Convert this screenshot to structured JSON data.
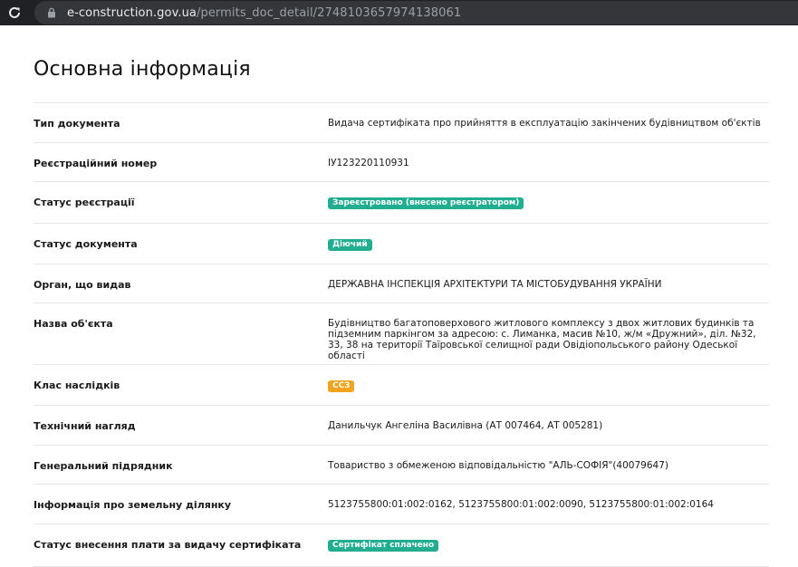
{
  "browser": {
    "url_host": "e-construction.gov.ua",
    "url_path": "/permits_doc_detail/2748103657974138061",
    "reload_icon": "reload-icon",
    "lock_icon": "lock-icon"
  },
  "page": {
    "title": "Основна інформація"
  },
  "rows": [
    {
      "label": "Тип документа",
      "value": "Видача сертифіката про прийняття в експлуатацію закінчених будівництвом об'єктів"
    },
    {
      "label": "Реєстраційний номер",
      "value": "ІУ123220110931"
    },
    {
      "label": "Статус реєстрації",
      "value": "Зареєстровано (внесено реєстратором)"
    },
    {
      "label": "Статус документа",
      "value": "Діючий"
    },
    {
      "label": "Орган, що видав",
      "value": "ДЕРЖАВНА ІНСПЕКЦІЯ АРХІТЕКТУРИ ТА МІСТОБУДУВАННЯ УКРАЇНИ"
    },
    {
      "label": "Назва об'єкта",
      "value": "Будівництво багатоповерхового житлового комплексу з двох житлових будинків та підземним паркінгом за адресою: с. Лиманка, масив №10, ж/м «Дружний», діл. №32, 33, 38 на території Таїровської селищної ради Овідіопольського району Одеської області"
    },
    {
      "label": "Клас наслідків",
      "value": "СС3"
    },
    {
      "label": "Технічний нагляд",
      "value": "Данильчук Ангеліна Василівна (АТ 007464, АТ 005281)"
    },
    {
      "label": "Генеральний підрядник",
      "value": "Товариство з обмеженою відповідальністю \"АЛЬ-СОФІЯ\"(40079647)"
    },
    {
      "label": "Інформація про земельну ділянку",
      "value": "5123755800:01:002:0162, 5123755800:01:002:0090, 5123755800:01:002:0164"
    },
    {
      "label": "Статус внесення плати за видачу сертифіката",
      "value": "Сертифікат сплачено"
    }
  ],
  "colors": {
    "badge_green": "#21ad8f",
    "badge_orange": "#f0a31c",
    "browser_bar": "#202124",
    "url_pill": "#35363a"
  }
}
